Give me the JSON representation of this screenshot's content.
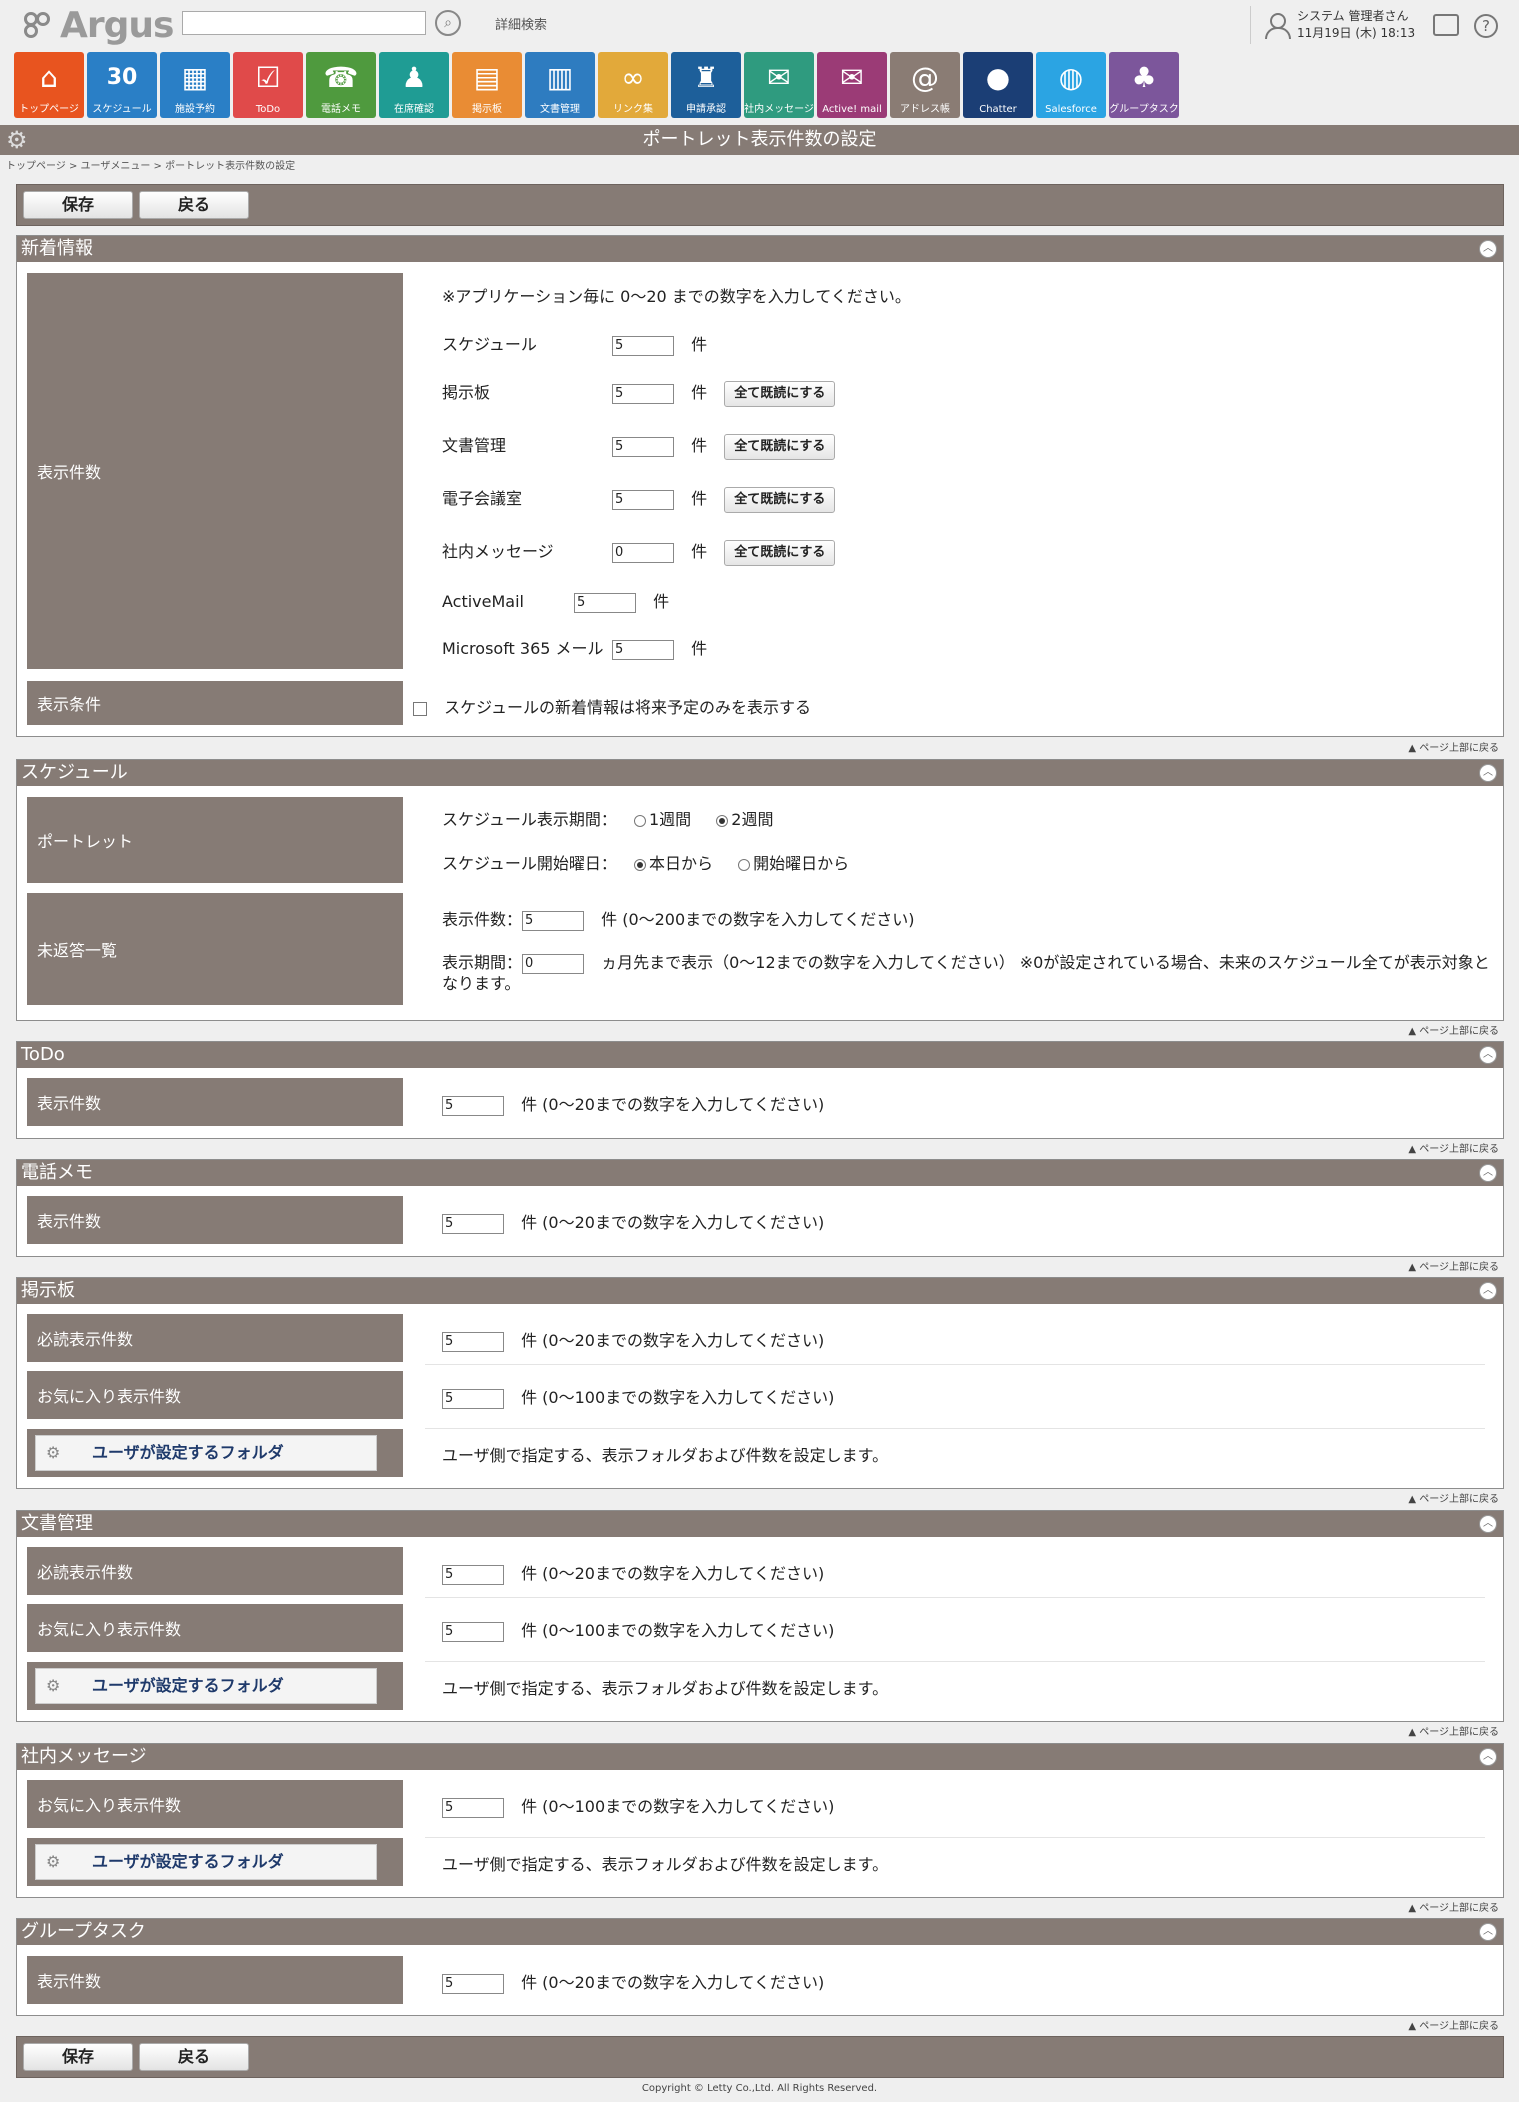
{
  "header": {
    "logo_text": "Argus",
    "search_placeholder": "",
    "advanced_search": "詳細検索",
    "user_name": "システム 管理者さん",
    "datetime": "11月19日 (木) 18:13",
    "help_glyph": "?"
  },
  "apps": [
    {
      "label": "トップページ",
      "color": "#e8541f",
      "icon": "home-icon"
    },
    {
      "label": "スケジュール",
      "color": "#2a7fc6",
      "icon": "calendar-icon"
    },
    {
      "label": "施設予約",
      "color": "#2a7fc6",
      "icon": "facility-icon"
    },
    {
      "label": "ToDo",
      "color": "#e04a4a",
      "icon": "todo-icon"
    },
    {
      "label": "電話メモ",
      "color": "#4f9a3e",
      "icon": "phone-icon"
    },
    {
      "label": "在席確認",
      "color": "#1f9c94",
      "icon": "presence-icon"
    },
    {
      "label": "掲示板",
      "color": "#e98c34",
      "icon": "board-icon"
    },
    {
      "label": "文書管理",
      "color": "#2e7cc0",
      "icon": "documents-icon"
    },
    {
      "label": "リンク集",
      "color": "#e2a93a",
      "icon": "link-icon"
    },
    {
      "label": "申請承認",
      "color": "#1d5f9a",
      "icon": "approval-icon"
    },
    {
      "label": "社内メッセージ",
      "color": "#2f9b7f",
      "icon": "message-icon"
    },
    {
      "label": "Active! mail",
      "color": "#9b3b76",
      "icon": "mail-icon"
    },
    {
      "label": "アドレス帳",
      "color": "#8a7c74",
      "icon": "address-book-icon"
    },
    {
      "label": "Chatter",
      "color": "#1b3e75",
      "icon": "chatter-icon"
    },
    {
      "label": "Salesforce",
      "color": "#2ba4e3",
      "icon": "globe-icon"
    },
    {
      "label": "グループタスク",
      "color": "#7c569b",
      "icon": "group-task-icon"
    }
  ],
  "title": "ポートレット表示件数の設定",
  "breadcrumb": "トップページ > ユーザメニュー > ポートレット表示件数の設定",
  "buttons": {
    "save": "保存",
    "back": "戻る"
  },
  "page_top": "▲ ページ上部に戻る",
  "unit": "件",
  "mark_read": "全て既読にする",
  "user_folder": "ユーザが設定するフォルダ",
  "user_folder_desc": "ユーザ側で指定する、表示フォルダおよび件数を設定します。",
  "shinchaku": {
    "heading": "新着情報",
    "label_count": "表示件数",
    "label_cond": "表示条件",
    "note": "※アプリケーション毎に 0～20 までの数字を入力してください。",
    "items": [
      {
        "name": "スケジュール",
        "value": "5"
      },
      {
        "name": "掲示板",
        "value": "5"
      },
      {
        "name": "文書管理",
        "value": "5"
      },
      {
        "name": "電子会議室",
        "value": "5"
      },
      {
        "name": "社内メッセージ",
        "value": "0"
      },
      {
        "name": "ActiveMail",
        "value": "5"
      },
      {
        "name": "Microsoft 365 メール",
        "value": "5"
      }
    ],
    "cond_text": "スケジュールの新着情報は将来予定のみを表示する"
  },
  "schedule": {
    "heading": "スケジュール",
    "label_portlet": "ポートレット",
    "label_unanswered": "未返答一覧",
    "period_label": "スケジュール表示期間：",
    "period_opt1": "1週間",
    "period_opt2": "2週間",
    "start_label": "スケジュール開始曜日：",
    "start_opt1": "本日から",
    "start_opt2": "開始曜日から",
    "count_label": "表示件数：",
    "count_value": "5",
    "count_hint": "件 (0～200までの数字を入力してください)",
    "period2_label": "表示期間：",
    "period2_value": "0",
    "period2_hint_1": "ヵ月先まで表示（0～12までの数字を入力してください） ※0が設定されている場合、未来のスケジュール全てが表示対象と",
    "period2_hint_2": "なります。"
  },
  "todo": {
    "heading": "ToDo",
    "label": "表示件数",
    "value": "5",
    "hint": "件 (0～20までの数字を入力してください)"
  },
  "phone": {
    "heading": "電話メモ",
    "label": "表示件数",
    "value": "5",
    "hint": "件 (0～20までの数字を入力してください)"
  },
  "board": {
    "heading": "掲示板",
    "label1": "必読表示件数",
    "value1": "5",
    "hint1": "件 (0～20までの数字を入力してください)",
    "label2": "お気に入り表示件数",
    "value2": "5",
    "hint2": "件 (0～100までの数字を入力してください)"
  },
  "docs": {
    "heading": "文書管理",
    "label1": "必読表示件数",
    "value1": "5",
    "hint1": "件 (0～20までの数字を入力してください)",
    "label2": "お気に入り表示件数",
    "value2": "5",
    "hint2": "件 (0～100までの数字を入力してください)"
  },
  "msg": {
    "heading": "社内メッセージ",
    "label": "お気に入り表示件数",
    "value": "5",
    "hint": "件 (0～100までの数字を入力してください)"
  },
  "gtask": {
    "heading": "グループタスク",
    "label": "表示件数",
    "value": "5",
    "hint": "件 (0～20までの数字を入力してください)"
  },
  "footer": "Copyright © Letty Co.,Ltd. All Rights Reserved."
}
